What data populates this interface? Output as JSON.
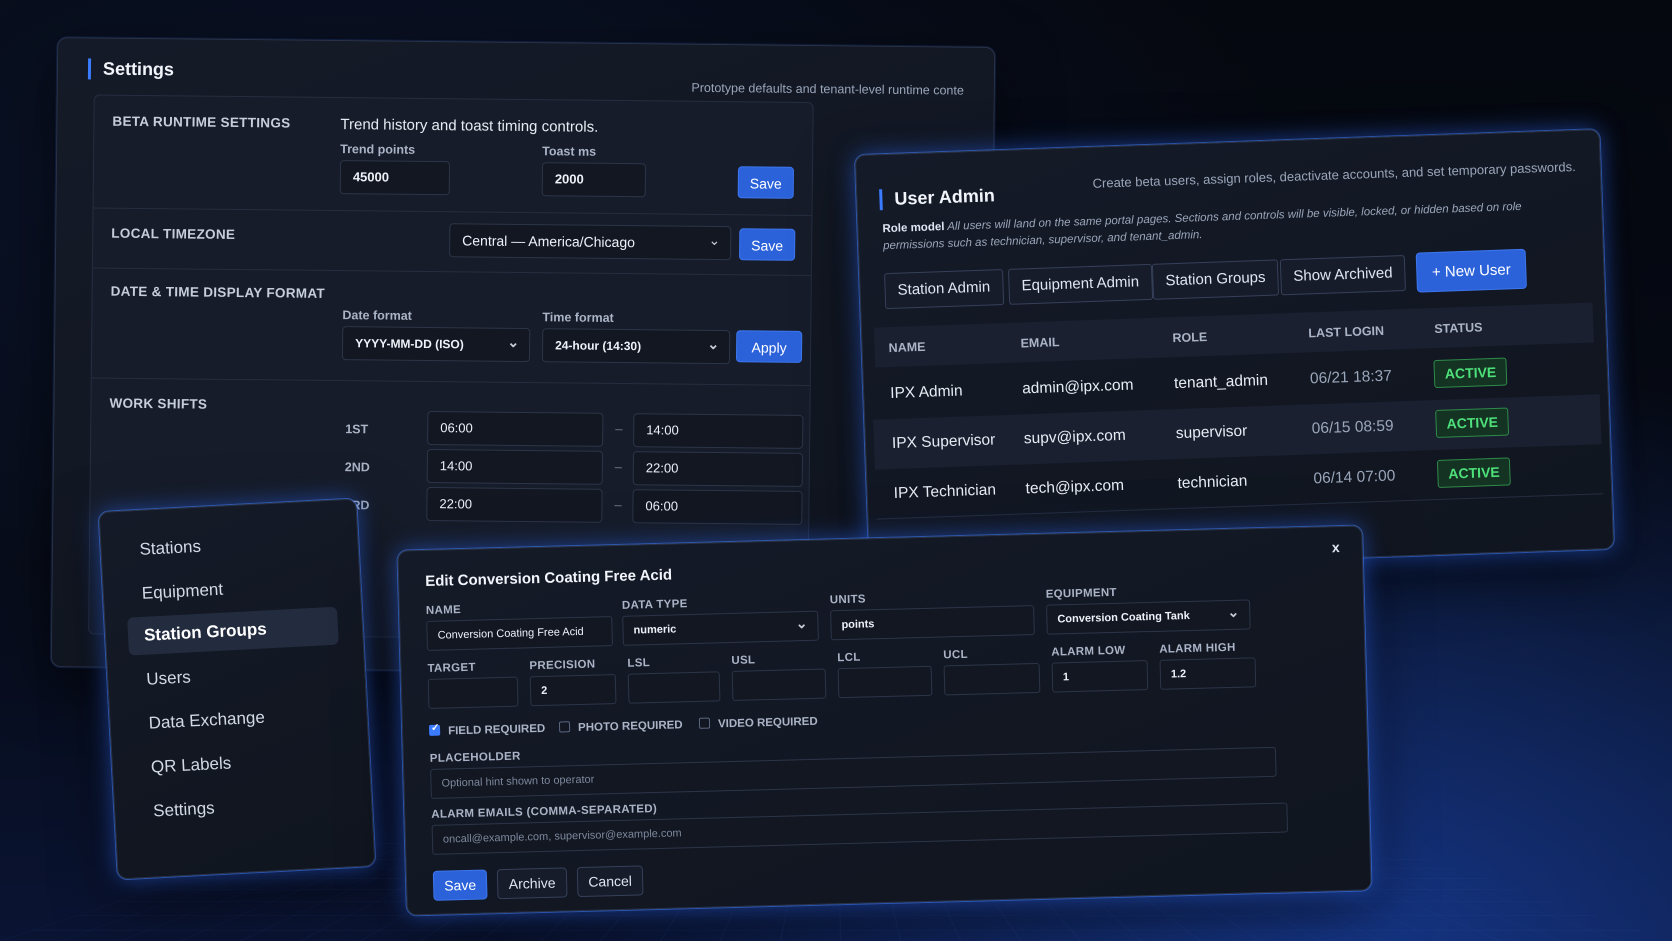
{
  "settings": {
    "title": "Settings",
    "subtitle": "Prototype defaults and tenant-level runtime conte",
    "beta": {
      "label": "BETA RUNTIME SETTINGS",
      "description": "Trend history and toast timing controls.",
      "trend_label": "Trend points",
      "trend_value": "45000",
      "toast_label": "Toast ms",
      "toast_value": "2000",
      "save_label": "Save"
    },
    "timezone": {
      "label": "LOCAL TIMEZONE",
      "value": "Central — America/Chicago",
      "save_label": "Save"
    },
    "datetime": {
      "label": "DATE & TIME DISPLAY FORMAT",
      "date_label": "Date format",
      "date_value": "YYYY-MM-DD (ISO)",
      "time_label": "Time format",
      "time_value": "24-hour (14:30)",
      "apply_label": "Apply"
    },
    "shifts": {
      "label": "WORK SHIFTS",
      "rows": [
        {
          "name": "1ST",
          "start": "06:00",
          "end": "14:00"
        },
        {
          "name": "2ND",
          "start": "14:00",
          "end": "22:00"
        },
        {
          "name": "3RD",
          "start": "22:00",
          "end": "06:00"
        }
      ],
      "separator": "–"
    }
  },
  "nav": {
    "items": [
      {
        "label": "Stations"
      },
      {
        "label": "Equipment"
      },
      {
        "label": "Station Groups",
        "active": true
      },
      {
        "label": "Users"
      },
      {
        "label": "Data Exchange"
      },
      {
        "label": "QR Labels"
      },
      {
        "label": "Settings"
      }
    ]
  },
  "user_admin": {
    "title": "User Admin",
    "subtitle": "Create beta users, assign roles, deactivate accounts, and set temporary passwords.",
    "role_model_label": "Role model",
    "role_model_text": "All users will land on the same portal pages. Sections and controls will be visible, locked, or hidden based on role permissions such as technician, supervisor, and tenant_admin.",
    "tabs": [
      "Station Admin",
      "Equipment Admin",
      "Station Groups",
      "Show Archived"
    ],
    "new_user_label": "+ New User",
    "columns": [
      "NAME",
      "EMAIL",
      "ROLE",
      "LAST LOGIN",
      "STATUS"
    ],
    "rows": [
      {
        "name": "IPX Admin",
        "email": "admin@ipx.com",
        "role": "tenant_admin",
        "last_login": "06/21 18:37",
        "status": "ACTIVE"
      },
      {
        "name": "IPX Supervisor",
        "email": "supv@ipx.com",
        "role": "supervisor",
        "last_login": "06/15 08:59",
        "status": "ACTIVE"
      },
      {
        "name": "IPX Technician",
        "email": "tech@ipx.com",
        "role": "technician",
        "last_login": "06/14 07:00",
        "status": "ACTIVE"
      }
    ],
    "status_color": "#4ee07a"
  },
  "edit_modal": {
    "title": "Edit Conversion Coating Free Acid",
    "close_label": "x",
    "fields": {
      "name": {
        "label": "NAME",
        "value": "Conversion Coating Free Acid"
      },
      "data_type": {
        "label": "DATA TYPE",
        "value": "numeric"
      },
      "units": {
        "label": "UNITS",
        "value": "points"
      },
      "equipment": {
        "label": "EQUIPMENT",
        "value": "Conversion Coating Tank"
      },
      "target": {
        "label": "TARGET",
        "value": ""
      },
      "precision": {
        "label": "PRECISION",
        "value": "2"
      },
      "lsl": {
        "label": "LSL",
        "value": ""
      },
      "usl": {
        "label": "USL",
        "value": ""
      },
      "lcl": {
        "label": "LCL",
        "value": ""
      },
      "ucl": {
        "label": "UCL",
        "value": ""
      },
      "alarm_low": {
        "label": "ALARM LOW",
        "value": "1"
      },
      "alarm_high": {
        "label": "ALARM HIGH",
        "value": "1.2"
      }
    },
    "checks": [
      {
        "label": "FIELD REQUIRED",
        "checked": true
      },
      {
        "label": "PHOTO REQUIRED",
        "checked": false
      },
      {
        "label": "VIDEO REQUIRED",
        "checked": false
      }
    ],
    "placeholder": {
      "label": "PLACEHOLDER",
      "placeholder": "Optional hint shown to operator"
    },
    "alarm_emails": {
      "label": "ALARM EMAILS (COMMA-SEPARATED)",
      "placeholder": "oncall@example.com, supervisor@example.com"
    },
    "save_label": "Save",
    "archive_label": "Archive",
    "cancel_label": "Cancel"
  },
  "colors": {
    "accent": "#2b62d9",
    "glow": "#3b7bff",
    "background": "#070b16"
  }
}
